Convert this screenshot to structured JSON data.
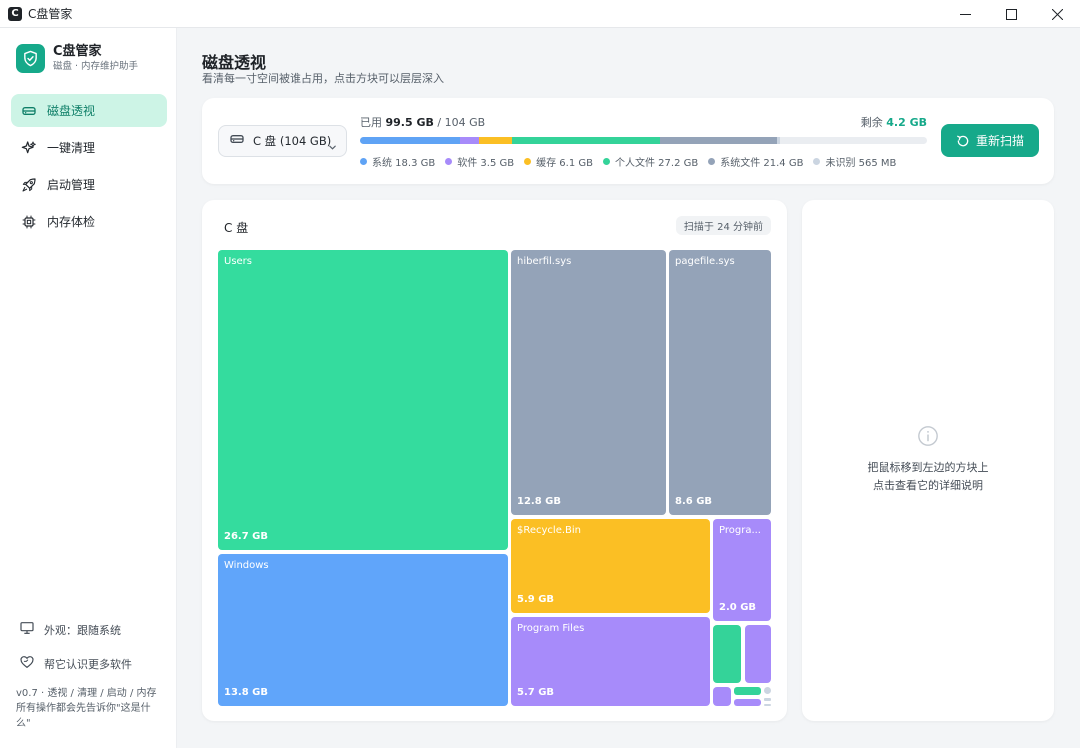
{
  "window": {
    "title": "C盘管家",
    "app_icon_letter": "C"
  },
  "brand": {
    "name": "C盘管家",
    "subtitle": "磁盘 · 内存维护助手"
  },
  "nav": [
    {
      "label": "磁盘透视",
      "icon": "drive-icon",
      "active": true
    },
    {
      "label": "一键清理",
      "icon": "sparkle-icon",
      "active": false
    },
    {
      "label": "启动管理",
      "icon": "rocket-icon",
      "active": false
    },
    {
      "label": "内存体检",
      "icon": "chip-icon",
      "active": false
    }
  ],
  "sidebar_bottom": {
    "appearance": "外观：跟随系统",
    "more_software": "帮它认识更多软件",
    "version_line1": "v0.7 · 透视 / 清理 / 启动 / 内存",
    "version_line2": "所有操作都会先告诉你\"这是什",
    "version_line3": "么\""
  },
  "header": {
    "title": "磁盘透视",
    "subtitle": "看清每一寸空间被谁占用，点击方块可以层层深入"
  },
  "disk": {
    "selector_label": "C 盘 (104 GB)",
    "used_prefix": "已用",
    "used_value": "99.5 GB",
    "total_text": "/ 104 GB",
    "free_prefix": "剩余",
    "free_value": "4.2 GB",
    "rescan_label": "重新扫描",
    "total_gb": 104,
    "segments": [
      {
        "label": "系统 18.3 GB",
        "gb": 18.3,
        "color": "#5fa3f5"
      },
      {
        "label": "软件 3.5 GB",
        "gb": 3.5,
        "color": "#a78bfa"
      },
      {
        "label": "缓存 6.1 GB",
        "gb": 6.1,
        "color": "#fbbf24"
      },
      {
        "label": "个人文件 27.2 GB",
        "gb": 27.2,
        "color": "#34d399"
      },
      {
        "label": "系统文件 21.4 GB",
        "gb": 21.4,
        "color": "#94a3b8"
      },
      {
        "label": "未识别 565 MB",
        "gb": 0.565,
        "color": "#cbd5e1"
      }
    ]
  },
  "treemap": {
    "title": "C 盘",
    "scan_badge": "扫描于 24 分钟前",
    "tiles": [
      {
        "name": "Users",
        "size": "26.7 GB",
        "color": "#34dc9e"
      },
      {
        "name": "Windows",
        "size": "13.8 GB",
        "color": "#60a5fa"
      },
      {
        "name": "hiberfil.sys",
        "size": "12.8 GB",
        "color": "#94a3b8"
      },
      {
        "name": "pagefile.sys",
        "size": "8.6 GB",
        "color": "#94a3b8"
      },
      {
        "name": "$Recycle.Bin",
        "size": "5.9 GB",
        "color": "#fbbf24"
      },
      {
        "name": "Progra...",
        "size": "2.0 GB",
        "color": "#a78bfa"
      },
      {
        "name": "Program Files",
        "size": "5.7 GB",
        "color": "#a78bfa"
      }
    ]
  },
  "detail": {
    "line1": "把鼠标移到左边的方块上",
    "line2": "点击查看它的详细说明"
  }
}
